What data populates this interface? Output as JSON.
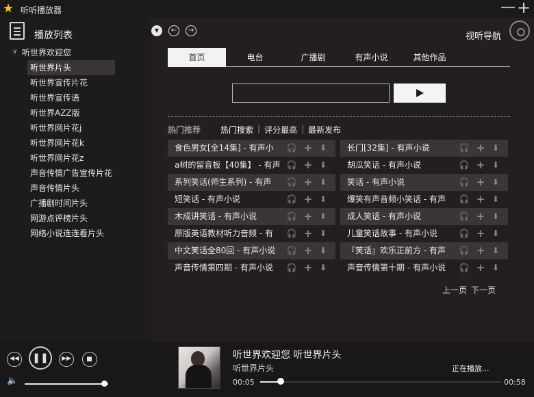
{
  "app": {
    "title": "听听播放器"
  },
  "window": {
    "min_glyph": "—",
    "add_glyph": "+"
  },
  "sidebar": {
    "title": "播放列表",
    "tree_root": "听世界欢迎您",
    "items": [
      "听世界片头",
      "听世界宣传片花",
      "听世界宣传语",
      "听世界AZZ版",
      "听世界网片花j",
      "听世界网片花k",
      "听世界网片花z",
      "声音传情广告宣传片花",
      "声音传情片头",
      "广播剧时间片头",
      "网游点评榜片头",
      "网络小说连连看片头"
    ]
  },
  "nav": {
    "title": "视听导航",
    "icons": [
      "dropdown-icon",
      "back-arrow-icon",
      "forward-arrow-icon",
      "disc-icon"
    ]
  },
  "tabs": [
    "首页",
    "电台",
    "广播剧",
    "有声小说",
    "其他作品"
  ],
  "search": {
    "value": "",
    "placeholder": ""
  },
  "hot": {
    "title": "热门推荐",
    "filters": [
      "热门搜索",
      "评分最高",
      "最新发布"
    ],
    "left": [
      "食色男女[全14集] - 有声小",
      "a树的留音板【40集】 - 有声",
      "系列笑话(师生系列) - 有声",
      "短笑话 - 有声小说",
      "木成讲笑话 - 有声小说",
      "原版英语教材听力音频 - 有",
      "中文笑话全80回 - 有声小说",
      "声音传情第四期 - 有声小说"
    ],
    "right": [
      "长门[32集] - 有声小说",
      "胡瓜笑话 - 有声小说",
      "笑话 - 有声小说",
      "爆笑有声音频小笑话 - 有声",
      "成人笑话 - 有声小说",
      "儿童笑话故事 - 有声小说",
      "『笑话』欢乐正前方 - 有声",
      "声音传情第十期 - 有声小说"
    ]
  },
  "pager": {
    "prev": "上一页",
    "next": "下一页"
  },
  "player": {
    "now_playing": "听世界欢迎您  听世界片头",
    "subtitle": "听世界片头",
    "elapsed": "00:05",
    "total": "00:58",
    "status": "正在播放...",
    "progress": 0.086,
    "volume": 0.95
  },
  "colors": {
    "background": "#231f21",
    "sidebar": "#1e1b1c",
    "row_alt": "#3a3638",
    "accent_star": "#f5c518"
  }
}
